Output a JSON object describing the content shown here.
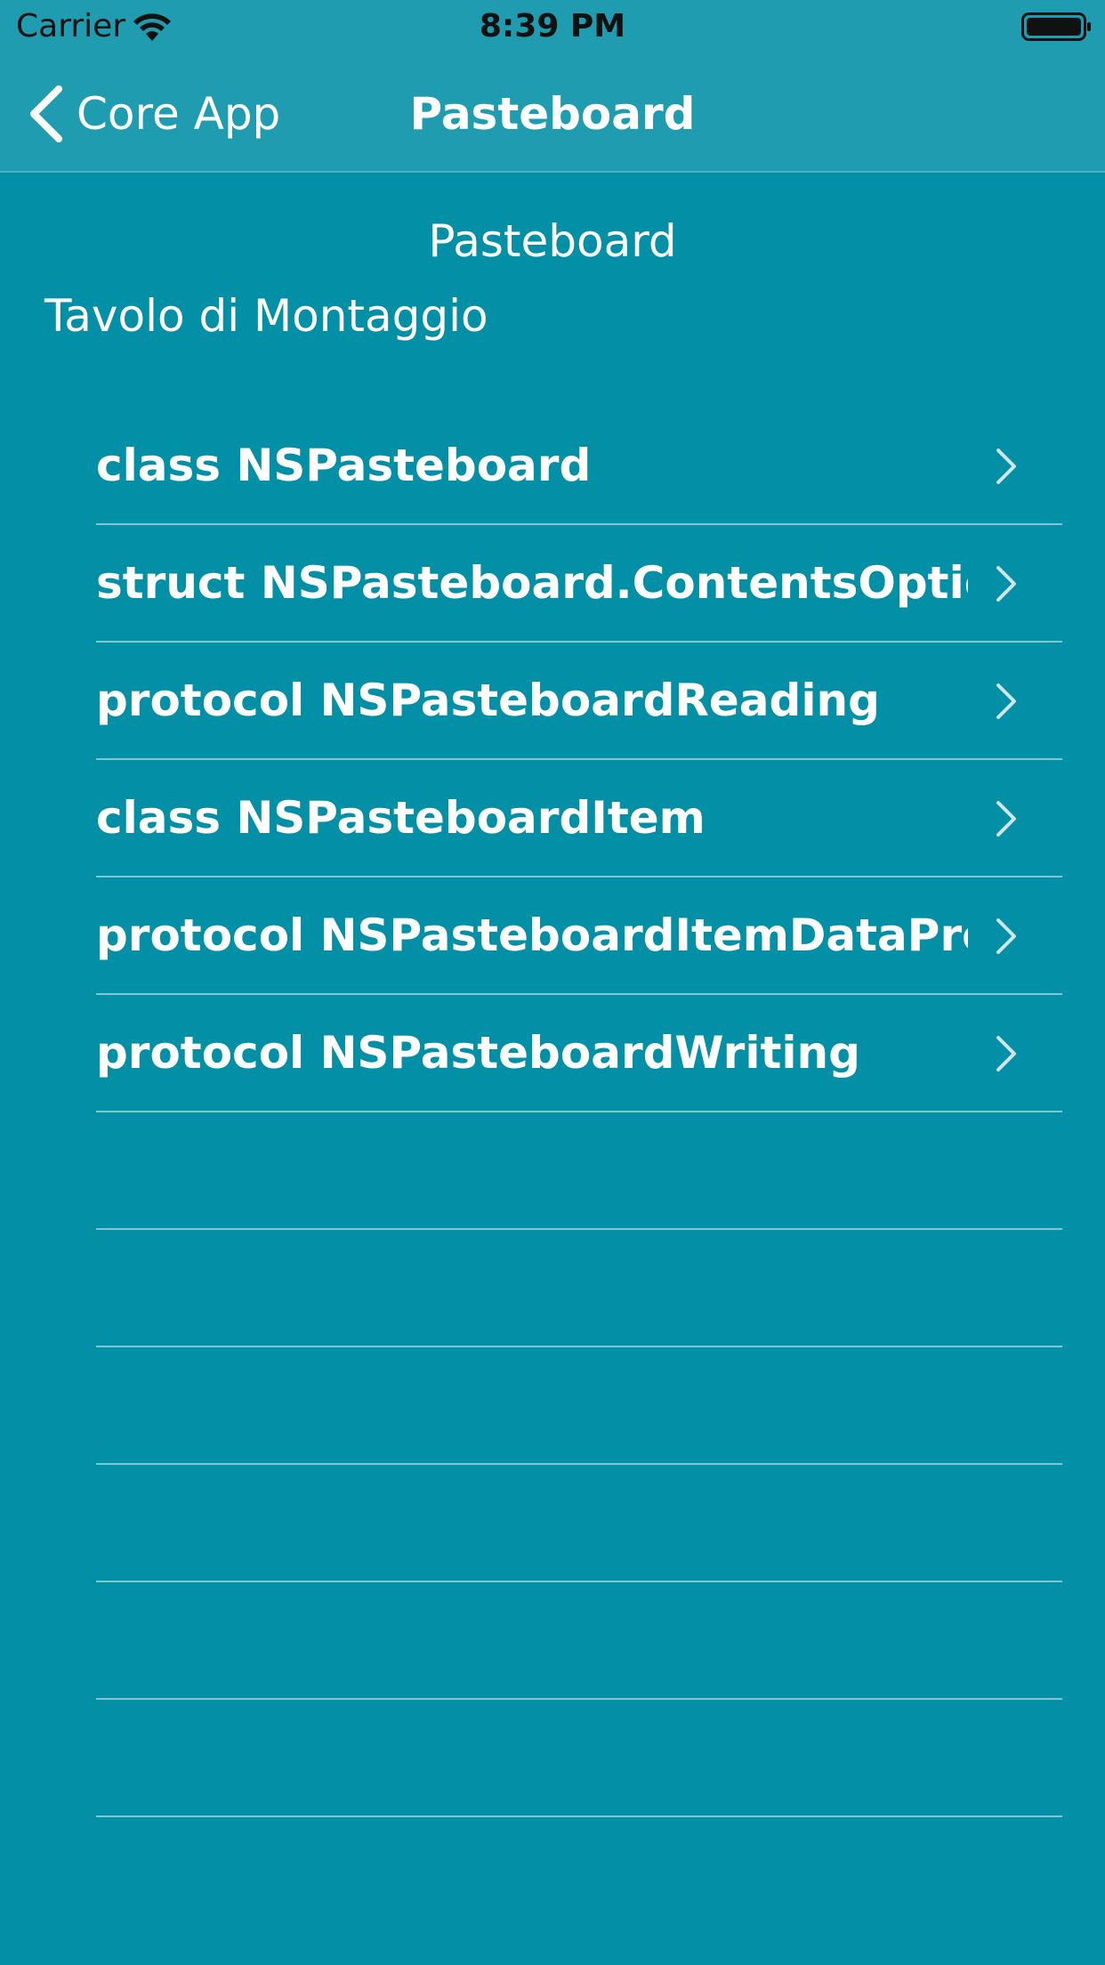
{
  "status_bar": {
    "carrier": "Carrier",
    "time": "8:39 PM"
  },
  "nav": {
    "back_label": "Core App",
    "title": "Pasteboard"
  },
  "content": {
    "section_title": "Pasteboard",
    "subtitle": "Tavolo di Montaggio"
  },
  "rows": [
    {
      "label": "class NSPasteboard"
    },
    {
      "label": "struct NSPasteboard.ContentsOptions"
    },
    {
      "label": "protocol NSPasteboardReading"
    },
    {
      "label": "class NSPasteboardItem"
    },
    {
      "label": "protocol NSPasteboardItemDataProvi..."
    },
    {
      "label": "protocol NSPasteboardWriting"
    }
  ],
  "empty_row_count": 6,
  "colors": {
    "background": "#038fa6",
    "nav_background": "#1f9caf",
    "separator": "#7fc8d3",
    "text": "#ffffff",
    "chevron": "#cfe6eb"
  }
}
